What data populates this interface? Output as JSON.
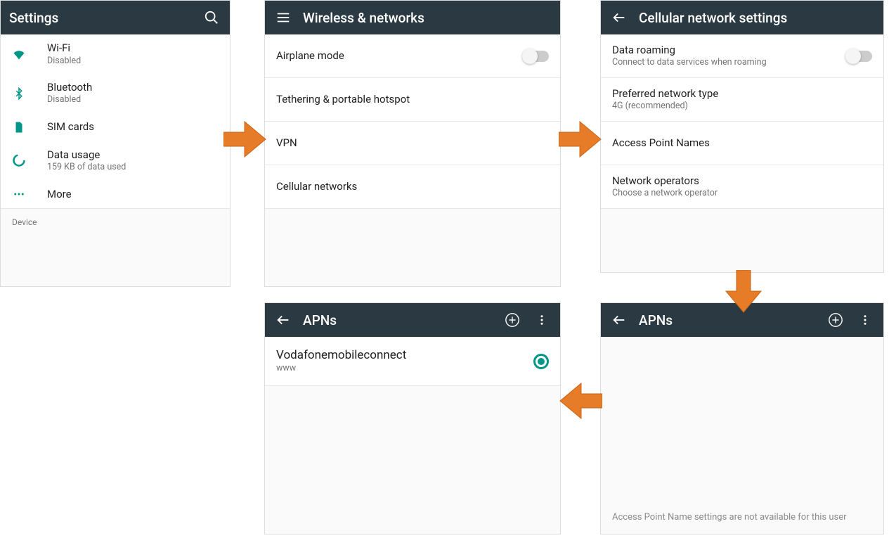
{
  "settings": {
    "title": "Settings",
    "items": [
      {
        "icon": "wifi",
        "label": "Wi-Fi",
        "sub": "Disabled"
      },
      {
        "icon": "bluetooth",
        "label": "Bluetooth",
        "sub": "Disabled"
      },
      {
        "icon": "sim",
        "label": "SIM cards",
        "sub": ""
      },
      {
        "icon": "data",
        "label": "Data usage",
        "sub": "159 KB of data used"
      },
      {
        "icon": "more",
        "label": "More",
        "sub": ""
      }
    ],
    "section": "Device"
  },
  "wireless": {
    "title": "Wireless & networks",
    "items": [
      {
        "label": "Airplane mode",
        "toggle": true
      },
      {
        "label": "Tethering & portable hotspot"
      },
      {
        "label": "VPN"
      },
      {
        "label": "Cellular networks"
      }
    ]
  },
  "cellular": {
    "title": "Cellular network settings",
    "items": [
      {
        "label": "Data roaming",
        "sub": "Connect to data services when roaming",
        "toggle": true
      },
      {
        "label": "Preferred network type",
        "sub": "4G (recommended)"
      },
      {
        "label": "Access Point Names"
      },
      {
        "label": "Network operators",
        "sub": "Choose a network operator"
      }
    ]
  },
  "apns_list": {
    "title": "APNs",
    "item": {
      "label": "Vodafonemobileconnect",
      "sub": "www"
    }
  },
  "apns_empty": {
    "title": "APNs",
    "message": "Access Point Name settings are not available for this user"
  }
}
